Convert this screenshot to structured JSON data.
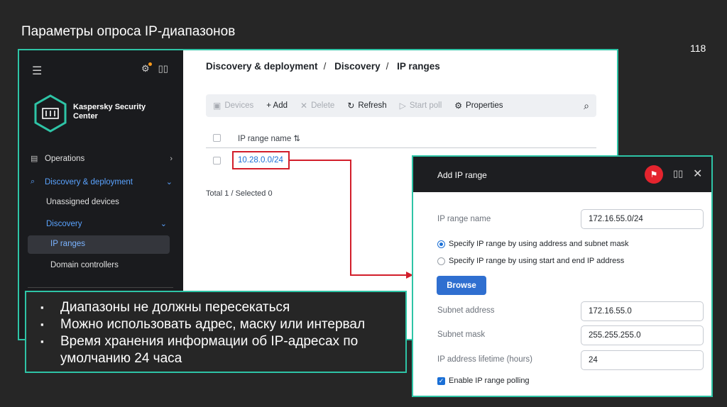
{
  "slide": {
    "title": "Параметры опроса IP-диапазонов",
    "page_number": "118"
  },
  "sidebar": {
    "logo_text": "Kaspersky Security Center",
    "items": [
      {
        "label": "Operations",
        "icon": "operations-icon"
      },
      {
        "label": "Discovery & deployment",
        "icon": "search-icon"
      }
    ],
    "sub_items": [
      "Unassigned devices",
      "Discovery",
      "IP ranges",
      "Domain controllers"
    ]
  },
  "content": {
    "breadcrumb": [
      "Discovery & deployment",
      "Discovery",
      "IP ranges"
    ],
    "toolbar": {
      "devices": "Devices",
      "add": "+ Add",
      "delete": "Delete",
      "refresh": "Refresh",
      "start_poll": "Start poll",
      "properties": "Properties"
    },
    "table": {
      "column": "IP range name ⇅",
      "rows": [
        "10.28.0.0/24"
      ]
    },
    "total": "Total 1 / Selected 0"
  },
  "dialog": {
    "title": "Add IP range",
    "ip_range_name_label": "IP range name",
    "ip_range_name_value": "172.16.55.0/24",
    "radio_mask": "Specify IP range by using address and subnet mask",
    "radio_start_end": "Specify IP range by using start and end IP address",
    "browse": "Browse",
    "subnet_address_label": "Subnet address",
    "subnet_address_value": "172.16.55.0",
    "subnet_mask_label": "Subnet mask",
    "subnet_mask_value": "255.255.255.0",
    "lifetime_label": "IP address lifetime (hours)",
    "lifetime_value": "24",
    "enable_polling": "Enable IP range polling"
  },
  "bullets": [
    "Диапазоны не должны пересекаться",
    "Можно использовать адрес, маску или интервал",
    "Время хранения информации об IP-адресах по умолчанию 24 часа"
  ],
  "colors": {
    "accent_frame": "#2ec4a6",
    "highlight": "#d21e2b",
    "link_blue": "#1a6fd6",
    "primary_button": "#2f6fd0"
  }
}
